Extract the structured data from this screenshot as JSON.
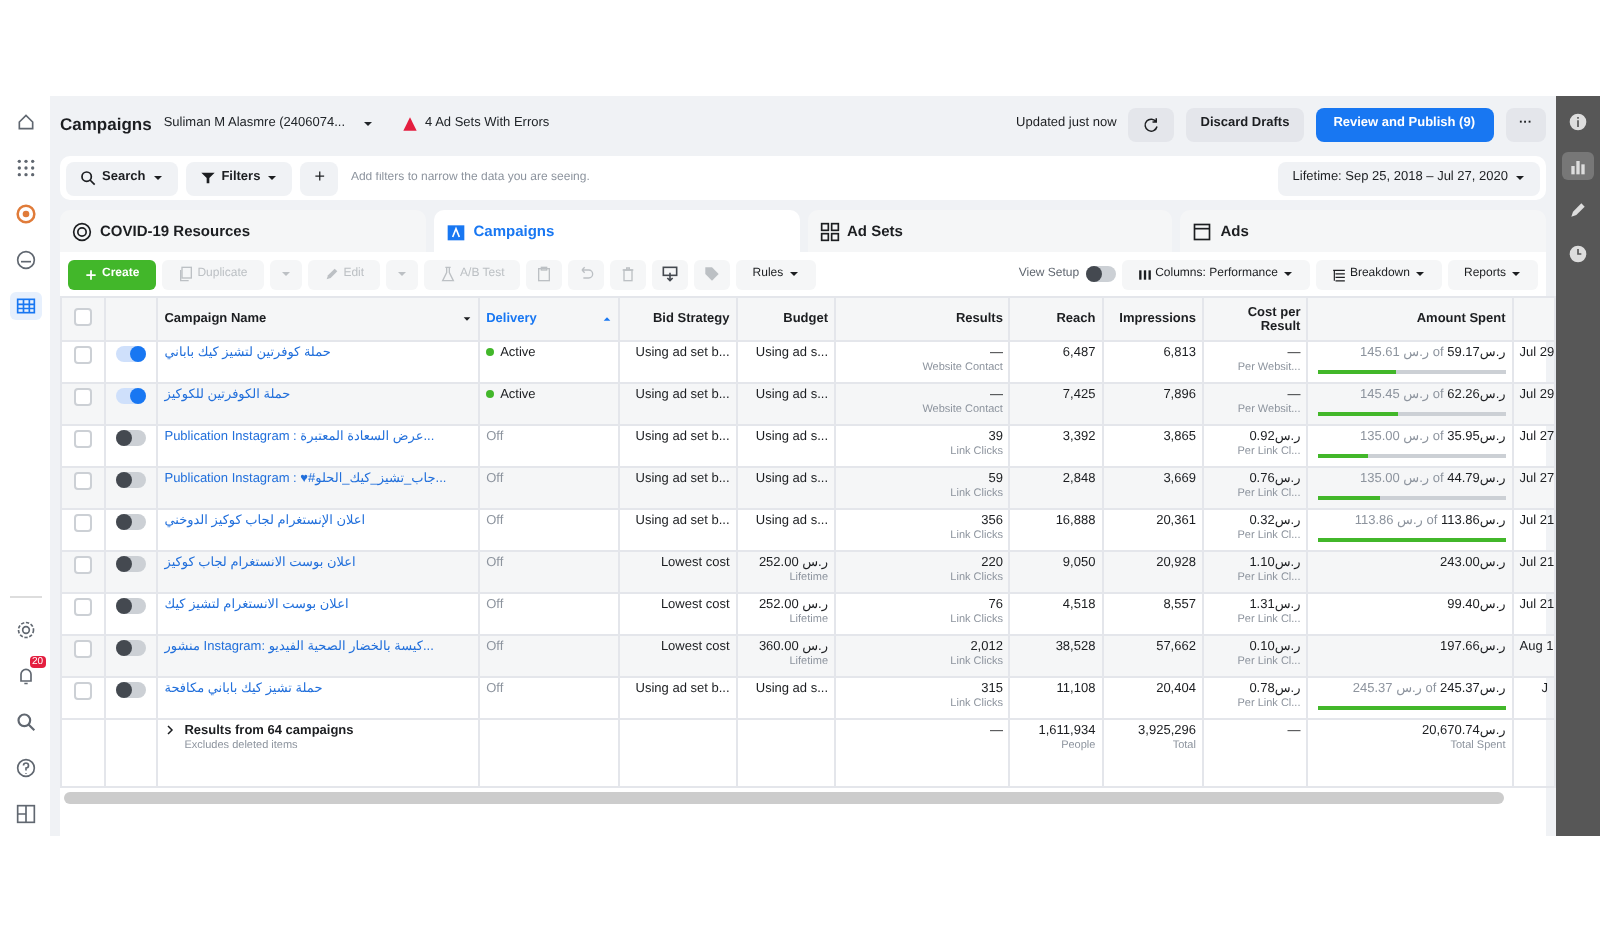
{
  "left_rail": {
    "top": [
      {
        "selected": false
      },
      {
        "selected": false
      },
      {
        "selected": false
      },
      {
        "selected": false
      },
      {
        "selected": true
      }
    ],
    "bottom": [
      {
        "selected": false
      },
      {
        "badge": "20",
        "selected": false
      },
      {
        "selected": false
      },
      {
        "selected": false
      },
      {
        "selected": false
      }
    ]
  },
  "header": {
    "title": "Campaigns",
    "account": "Suliman M Alasmre (2406074...",
    "errors": "4 Ad Sets With Errors",
    "updated": "Updated just now",
    "discard": "Discard Drafts",
    "publish": "Review and Publish (9)",
    "more": "···"
  },
  "filters": {
    "buttons": [
      {
        "label": "Search"
      },
      {
        "label": "Filters"
      }
    ],
    "add": "+",
    "placeholder": "Add filters to narrow the data you are seeing.",
    "date_range": "Lifetime: Sep 25, 2018 – Jul 27, 2020"
  },
  "tabs": [
    {
      "label": "COVID-19 Resources",
      "selected": false
    },
    {
      "label": "Campaigns",
      "selected": true
    },
    {
      "label": "Ad Sets",
      "selected": false
    },
    {
      "label": "Ads",
      "selected": false
    }
  ],
  "toolbar": {
    "items": [
      {
        "kind": "create",
        "label": "Create"
      },
      {
        "kind": "split",
        "label": "Duplicate",
        "disabled": true
      },
      {
        "kind": "split",
        "label": "Edit",
        "disabled": true
      },
      {
        "kind": "button",
        "label": "A/B Test",
        "disabled": true
      },
      {
        "kind": "icon",
        "disabled": true
      },
      {
        "kind": "icon",
        "disabled": true
      },
      {
        "kind": "icon",
        "disabled": true
      },
      {
        "kind": "icon",
        "disabled": false
      },
      {
        "kind": "icon",
        "disabled": true
      },
      {
        "kind": "menu",
        "label": "Rules",
        "disabled": false
      }
    ],
    "view_setup": {
      "label": "View Setup",
      "on": false
    },
    "menus": [
      {
        "label": "Columns: Performance"
      },
      {
        "label": "Breakdown"
      },
      {
        "label": "Reports"
      }
    ]
  },
  "table": {
    "select_all_checked": false,
    "columns": [
      {
        "label": "Campaign Name",
        "sorted": false
      },
      {
        "label": "Delivery",
        "sorted": true
      },
      {
        "label": "Bid Strategy",
        "sorted": false
      },
      {
        "label": "Budget",
        "sorted": false
      },
      {
        "label": "Results",
        "sorted": false
      },
      {
        "label": "Reach",
        "sorted": false
      },
      {
        "label": "Impressions",
        "sorted": false
      },
      {
        "label": "Cost per Result",
        "sorted": false
      },
      {
        "label": "Amount Spent",
        "sorted": false
      }
    ],
    "rows": [
      {
        "checked": false,
        "on": true,
        "name": "حملة كوفرتين لتشيز كيك باباني",
        "delivery": "Active",
        "active": true,
        "bid": "Using ad set b...",
        "budget": "Using ad s...",
        "results": "—",
        "results_note": "Website Contact",
        "reach": "6,487",
        "impressions": "6,813",
        "cost": "—",
        "cost_note": "Per Websit...",
        "spent_of": "ر.س 145.61 of",
        "amount": "ر.س59.17",
        "level": 0.41,
        "date": "Jul 29"
      },
      {
        "checked": false,
        "on": true,
        "name": "حملة الكوفرتين للكوكيز",
        "delivery": "Active",
        "active": true,
        "bid": "Using ad set b...",
        "budget": "Using ad s...",
        "results": "—",
        "results_note": "Website Contact",
        "reach": "7,425",
        "impressions": "7,896",
        "cost": "—",
        "cost_note": "Per Websit...",
        "spent_of": "ر.س 145.45 of",
        "amount": "ر.س62.26",
        "level": 0.43,
        "date": "Jul 29"
      },
      {
        "checked": false,
        "on": false,
        "name": "Publication Instagram : عرض السعادة المعتبرة...",
        "delivery": "Off",
        "active": false,
        "bid": "Using ad set b...",
        "budget": "Using ad s...",
        "results": "39",
        "results_note": "Link Clicks",
        "reach": "3,392",
        "impressions": "3,865",
        "cost": "ر.س0.92",
        "cost_note": "Per Link Cl...",
        "spent_of": "ر.س 135.00 of",
        "amount": "ر.س35.95",
        "level": 0.27,
        "date": "Jul 27"
      },
      {
        "checked": false,
        "on": false,
        "name": "Publication Instagram : ♥#جاب_تشيز_كيك_الحلو...",
        "delivery": "Off",
        "active": false,
        "bid": "Using ad set b...",
        "budget": "Using ad s...",
        "results": "59",
        "results_note": "Link Clicks",
        "reach": "2,848",
        "impressions": "3,669",
        "cost": "ر.س0.76",
        "cost_note": "Per Link Cl...",
        "spent_of": "ر.س 135.00 of",
        "amount": "ر.س44.79",
        "level": 0.33,
        "date": "Jul 27"
      },
      {
        "checked": false,
        "on": false,
        "name": "اعلان الإنستغرام لجاب كوكيز الدوخني",
        "delivery": "Off",
        "active": false,
        "bid": "Using ad set b...",
        "budget": "Using ad s...",
        "results": "356",
        "results_note": "Link Clicks",
        "reach": "16,888",
        "impressions": "20,361",
        "cost": "ر.س0.32",
        "cost_note": "Per Link Cl...",
        "spent_of": "ر.س 113.86 of",
        "amount": "ر.س113.86",
        "level": 1,
        "date": "Jul 21"
      },
      {
        "checked": false,
        "on": false,
        "name": "اعلان بوست الانستغرام لجاب كوكيز",
        "delivery": "Off",
        "active": false,
        "bid": "Lowest cost",
        "budget": "252.00 ر.س",
        "budget_note": "Lifetime",
        "results": "220",
        "results_note": "Link Clicks",
        "reach": "9,050",
        "impressions": "20,928",
        "cost": "ر.س1.10",
        "cost_note": "Per Link Cl...",
        "amount": "ر.س243.00",
        "date": "Jul 21"
      },
      {
        "checked": false,
        "on": false,
        "name": "اعلان بوست الانستغرام لتشيز كيك",
        "delivery": "Off",
        "active": false,
        "bid": "Lowest cost",
        "budget": "252.00 ر.س",
        "budget_note": "Lifetime",
        "results": "76",
        "results_note": "Link Clicks",
        "reach": "4,518",
        "impressions": "8,557",
        "cost": "ر.س1.31",
        "cost_note": "Per Link Cl...",
        "amount": "ر.س99.40",
        "date": "Jul 21"
      },
      {
        "checked": false,
        "on": false,
        "name": "منشور Instagram: كيسة بالخضار الصحية الفيديو...",
        "delivery": "Off",
        "active": false,
        "bid": "Lowest cost",
        "budget": "360.00 ر.س",
        "budget_note": "Lifetime",
        "results": "2,012",
        "results_note": "Link Clicks",
        "reach": "38,528",
        "impressions": "57,662",
        "cost": "ر.س0.10",
        "cost_note": "Per Link Cl...",
        "amount": "ر.س197.66",
        "date": "Aug 1"
      },
      {
        "checked": false,
        "on": false,
        "name": "حملة تشيز كيك باباني مكافحة",
        "delivery": "Off",
        "active": false,
        "bid": "Using ad set b...",
        "budget": "Using ad s...",
        "results": "315",
        "results_note": "Link Clicks",
        "reach": "11,108",
        "impressions": "20,404",
        "cost": "ر.س0.78",
        "cost_note": "Per Link Cl...",
        "spent_of": "ر.س 245.37 of",
        "amount": "ر.س245.37",
        "level": 1,
        "date": "J"
      }
    ],
    "footer": {
      "title": "Results from 64 campaigns",
      "note": "Excludes deleted items",
      "results": "—",
      "reach": "1,611,934",
      "reach_note": "People",
      "impressions": "3,925,296",
      "impressions_note": "Total",
      "cost": "—",
      "amount": "ر.س20,670.74",
      "amount_note": "Total Spent"
    }
  },
  "right_rail": [
    {
      "selected": false
    },
    {
      "selected": true
    },
    {
      "selected": false
    },
    {
      "selected": false
    }
  ]
}
